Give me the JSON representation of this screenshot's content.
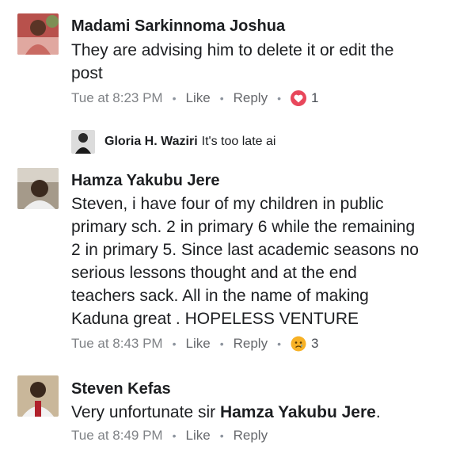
{
  "comments": [
    {
      "author": "Madami Sarkinnoma Joshua",
      "text_lines": [
        "They are advising him to delete it or edit the",
        "post"
      ],
      "time": "Tue at 8:23 PM",
      "like": "Like",
      "reply": "Reply",
      "reaction_icon": "heart-icon",
      "reaction_count": "1",
      "reply_preview": {
        "author": "Gloria H. Waziri",
        "text": "It's too late ai"
      }
    },
    {
      "author": "Hamza Yakubu Jere",
      "text_lines": [
        "Steven, i have four of my children in public",
        "primary sch. 2 in primary 6 while the remaining",
        "2 in primary 5. Since last academic seasons no",
        "serious lessons thought and at the end",
        "teachers sack. All in the name of making",
        "Kaduna great .  HOPELESS VENTURE"
      ],
      "time": "Tue at 8:43 PM",
      "like": "Like",
      "reply": "Reply",
      "reaction_icon": "sad-face-icon",
      "reaction_count": "3"
    },
    {
      "author": "Steven Kefas",
      "text_prefix": "Very unfortunate sir ",
      "text_mention": "Hamza Yakubu Jere",
      "text_suffix": ".",
      "time": "Tue at 8:49 PM",
      "like": "Like",
      "reply": "Reply"
    }
  ],
  "separator": "•",
  "colors": {
    "heart": "#e8475b",
    "sad": "#f7b125",
    "meta": "#7f8286"
  }
}
